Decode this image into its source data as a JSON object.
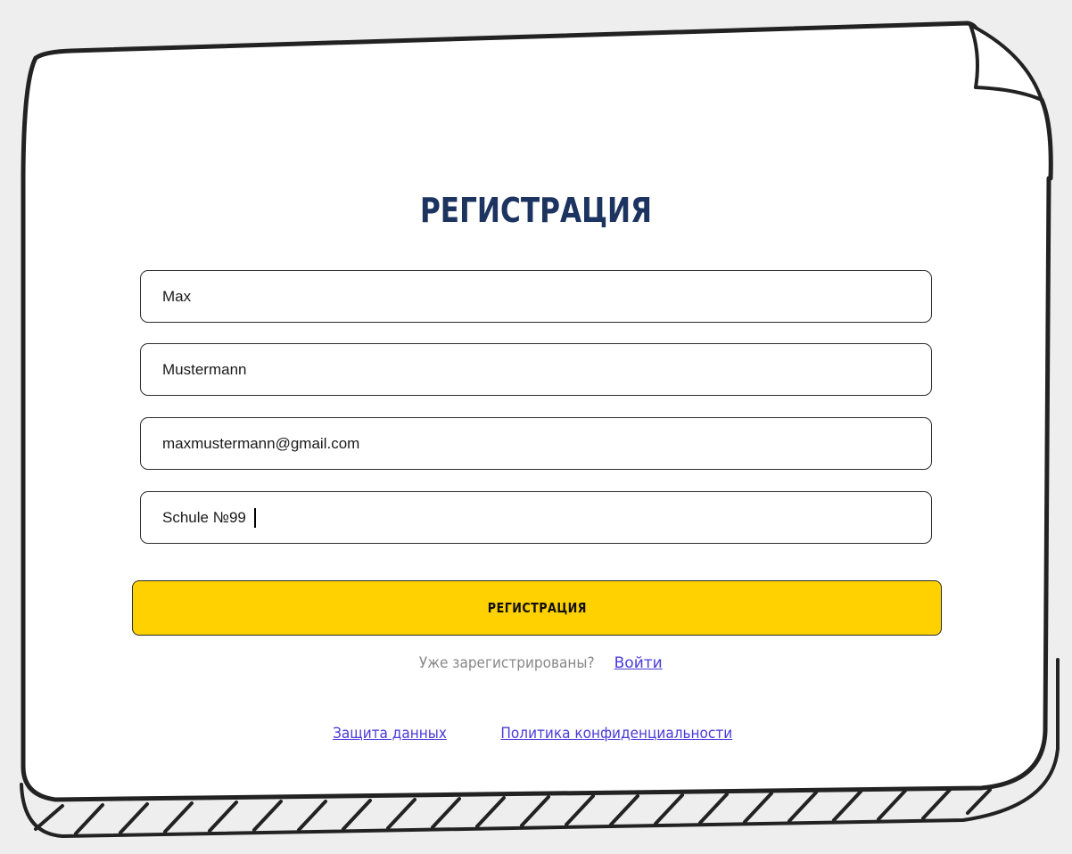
{
  "page": {
    "title": "РЕГИСТРАЦИЯ"
  },
  "form": {
    "first_name": "Max",
    "last_name": "Mustermann",
    "email": "maxmustermann@gmail.com",
    "school": "Schule №99",
    "submit_label": "РЕГИСТРАЦИЯ"
  },
  "login": {
    "question": "Уже зарегистрированы?",
    "link_label": "Войти"
  },
  "footer": {
    "data_protection": "Защита данных",
    "privacy_policy": "Политика конфиденциальности"
  },
  "colors": {
    "title": "#1d3461",
    "button": "#ffd100",
    "link": "#4a3bd9",
    "background": "#eeeeee"
  }
}
